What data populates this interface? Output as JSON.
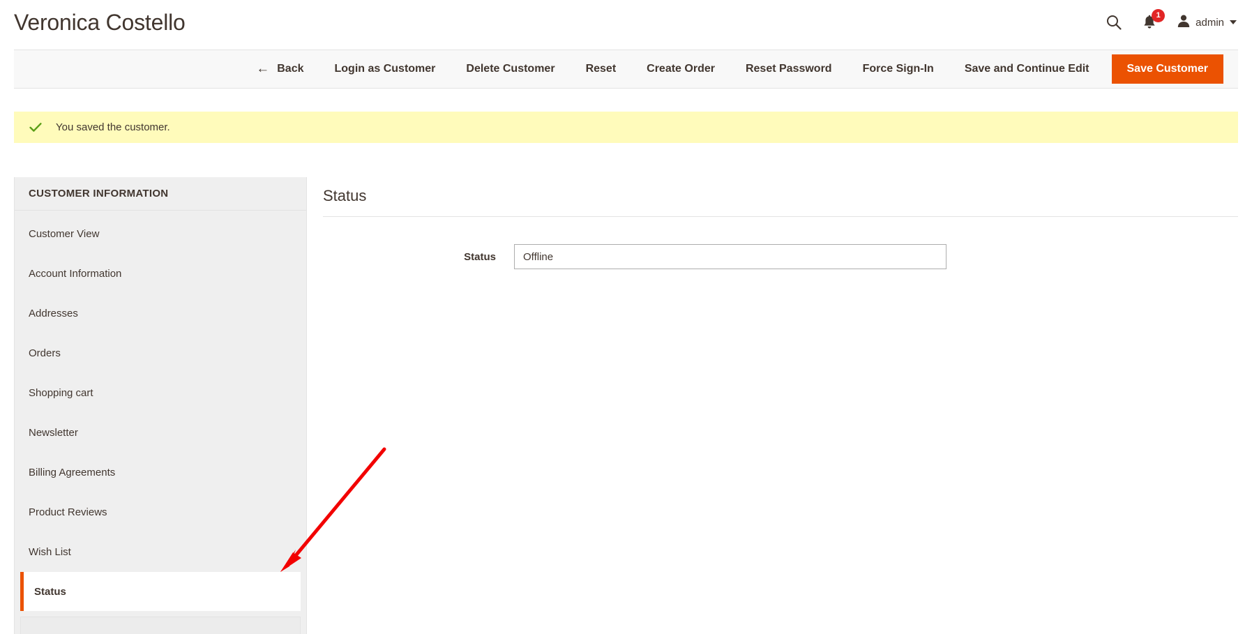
{
  "header": {
    "title": "Veronica Costello",
    "search_icon": "search-icon",
    "notifications_icon": "bell-icon",
    "notifications_count": "1",
    "admin_icon": "user-avatar-icon",
    "admin_label": "admin",
    "caret_icon": "chevron-down-icon"
  },
  "toolbar": {
    "back_icon": "arrow-left-icon",
    "back_label": "Back",
    "login_as_customer_label": "Login as Customer",
    "delete_customer_label": "Delete Customer",
    "reset_label": "Reset",
    "create_order_label": "Create Order",
    "reset_password_label": "Reset Password",
    "force_sign_in_label": "Force Sign-In",
    "save_and_continue_label": "Save and Continue Edit",
    "save_customer_label": "Save Customer",
    "primary_color": "#eb5202"
  },
  "message": {
    "icon": "check-icon",
    "text": "You saved the customer.",
    "background_color": "#fffbbb",
    "icon_color": "#5a9e16"
  },
  "sidebar": {
    "heading": "CUSTOMER INFORMATION",
    "items": [
      {
        "label": "Customer View",
        "active": false
      },
      {
        "label": "Account Information",
        "active": false
      },
      {
        "label": "Addresses",
        "active": false
      },
      {
        "label": "Orders",
        "active": false
      },
      {
        "label": "Shopping cart",
        "active": false
      },
      {
        "label": "Newsletter",
        "active": false
      },
      {
        "label": "Billing Agreements",
        "active": false
      },
      {
        "label": "Product Reviews",
        "active": false
      },
      {
        "label": "Wish List",
        "active": false
      },
      {
        "label": "Status",
        "active": true
      }
    ],
    "active_accent_color": "#eb5202"
  },
  "main": {
    "section_title": "Status",
    "field": {
      "label": "Status",
      "value": "Offline"
    }
  },
  "annotation": {
    "arrow_color": "#f20000",
    "arrow_name": "red-pointer-arrow"
  }
}
